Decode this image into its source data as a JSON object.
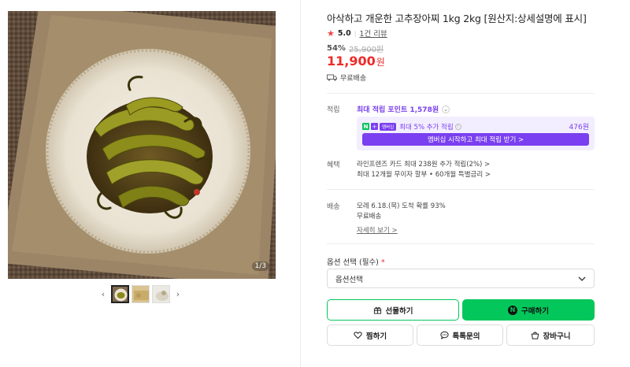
{
  "gallery": {
    "counter": "1/3",
    "prev_icon": "chevron-left-icon",
    "next_icon": "chevron-right-icon"
  },
  "product": {
    "title": "아삭하고 개운한 고추장아찌 1kg 2kg [원산지:상세설명에 표시]",
    "rating_score": "5.0",
    "rating_separator": "|",
    "review_link": "1건 리뷰",
    "discount_rate": "54%",
    "original_price": "25,900원",
    "price": "11,900",
    "price_unit": "원",
    "shipping_text": "무료배송"
  },
  "points": {
    "label": "적립",
    "max_points": "최대 적립 포인트 1,578원",
    "membership_badge": "멤버십",
    "membership_text_prefix": "최대 5% 추가 적립",
    "membership_amount": "476원",
    "membership_button": "멤버십 시작하고 최대 적립 받기 >"
  },
  "benefit": {
    "label": "혜택",
    "line1": "라인프렌즈 카드 최대 238원 추가 적립(2%) >",
    "line2": "최대 12개월 무이자 할부 • 60개월 특별금리 >"
  },
  "delivery": {
    "label": "배송",
    "line1": "모레 6.18.(목) 도착 확률 93%",
    "line2": "무료배송",
    "detail_link": "자세히 보기 >"
  },
  "options": {
    "label": "옵션 선택 (필수)",
    "required_mark": "*",
    "select_value": "옵션선택"
  },
  "actions": {
    "gift": "선물하기",
    "buy": "구매하기",
    "wish": "찜하기",
    "talk": "톡톡문의",
    "cart": "장바구니"
  },
  "colors": {
    "accent_green": "#03c75a",
    "price_red": "#f02a2a",
    "membership_purple": "#7a3ff0"
  }
}
